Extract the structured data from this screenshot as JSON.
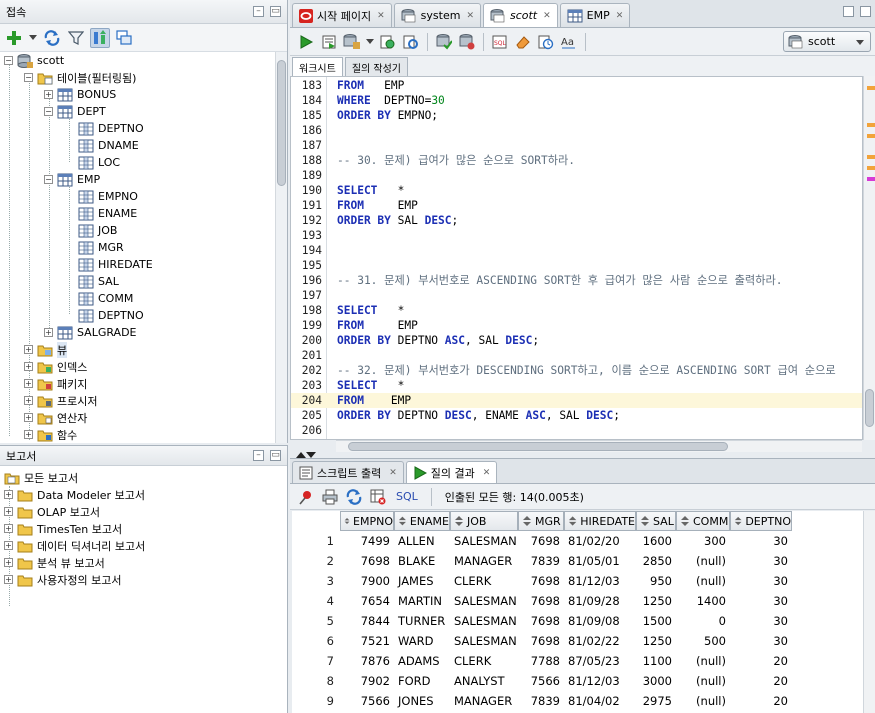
{
  "connections_panel": {
    "title": "접속",
    "tree": {
      "root": "scott",
      "tables_folder": "테이블(필터링됨)",
      "tables": [
        "BONUS",
        "DEPT",
        "EMP",
        "SALGRADE"
      ],
      "dept_columns": [
        "DEPTNO",
        "DNAME",
        "LOC"
      ],
      "emp_columns": [
        "EMPNO",
        "ENAME",
        "JOB",
        "MGR",
        "HIREDATE",
        "SAL",
        "COMM",
        "DEPTNO"
      ],
      "other_folders": [
        "뷰",
        "인덱스",
        "패키지",
        "프로시저",
        "연산자",
        "함수"
      ]
    }
  },
  "reports_panel": {
    "title": "보고서",
    "root": "모든 보고서",
    "items": [
      "Data Modeler 보고서",
      "OLAP 보고서",
      "TimesTen 보고서",
      "데이터 딕셔너리 보고서",
      "분석 뷰 보고서",
      "사용자정의 보고서"
    ]
  },
  "doc_tabs": [
    "시작 페이지",
    "system",
    "scott",
    "EMP"
  ],
  "active_doc_tab": "scott",
  "connection_selector": "scott",
  "sub_tabs": [
    "워크시트",
    "질의 작성기"
  ],
  "editor": {
    "lines": [
      {
        "n": "183",
        "parts": [
          [
            "kw",
            "FROM"
          ],
          [
            "t",
            "   EMP"
          ]
        ]
      },
      {
        "n": "184",
        "parts": [
          [
            "kw",
            "WHERE"
          ],
          [
            "t",
            "  DEPTNO="
          ],
          [
            "num",
            "30"
          ]
        ]
      },
      {
        "n": "185",
        "parts": [
          [
            "kw",
            "ORDER BY"
          ],
          [
            "t",
            " EMPNO;"
          ]
        ]
      },
      {
        "n": "186",
        "parts": []
      },
      {
        "n": "187",
        "parts": []
      },
      {
        "n": "188",
        "parts": [
          [
            "cm",
            "-- 30. 문제) 급여가 많은 순으로 SORT하라."
          ]
        ]
      },
      {
        "n": "189",
        "parts": []
      },
      {
        "n": "190",
        "parts": [
          [
            "kw",
            "SELECT"
          ],
          [
            "t",
            "   *"
          ]
        ]
      },
      {
        "n": "191",
        "parts": [
          [
            "kw",
            "FROM"
          ],
          [
            "t",
            "     EMP"
          ]
        ]
      },
      {
        "n": "192",
        "parts": [
          [
            "kw",
            "ORDER BY"
          ],
          [
            "t",
            " SAL "
          ],
          [
            "kw",
            "DESC"
          ],
          [
            "t",
            ";"
          ]
        ]
      },
      {
        "n": "193",
        "parts": []
      },
      {
        "n": "194",
        "parts": []
      },
      {
        "n": "195",
        "parts": []
      },
      {
        "n": "196",
        "parts": [
          [
            "cm",
            "-- 31. 문제) 부서번호로 ASCENDING SORT한 후 급여가 많은 사람 순으로 출력하라."
          ]
        ]
      },
      {
        "n": "197",
        "parts": []
      },
      {
        "n": "198",
        "parts": [
          [
            "kw",
            "SELECT"
          ],
          [
            "t",
            "   *"
          ]
        ]
      },
      {
        "n": "199",
        "parts": [
          [
            "kw",
            "FROM"
          ],
          [
            "t",
            "     EMP"
          ]
        ]
      },
      {
        "n": "200",
        "parts": [
          [
            "kw",
            "ORDER BY"
          ],
          [
            "t",
            " DEPTNO "
          ],
          [
            "kw",
            "ASC"
          ],
          [
            "t",
            ", SAL "
          ],
          [
            "kw",
            "DESC"
          ],
          [
            "t",
            ";"
          ]
        ]
      },
      {
        "n": "201",
        "parts": []
      },
      {
        "n": "202",
        "parts": [
          [
            "cm",
            "-- 32. 문제) 부서번호가 DESCENDING SORT하고, 이름 순으로 ASCENDING SORT 급여 순으로"
          ]
        ]
      },
      {
        "n": "203",
        "parts": [
          [
            "kw",
            "SELECT"
          ],
          [
            "t",
            "   *"
          ]
        ]
      },
      {
        "n": "204",
        "parts": [
          [
            "kw",
            "FROM"
          ],
          [
            "t",
            "    EMP"
          ]
        ],
        "current": true
      },
      {
        "n": "205",
        "parts": [
          [
            "kw",
            "ORDER BY"
          ],
          [
            "t",
            " DEPTNO "
          ],
          [
            "kw",
            "DESC"
          ],
          [
            "t",
            ", ENAME "
          ],
          [
            "kw",
            "ASC"
          ],
          [
            "t",
            ", SAL "
          ],
          [
            "kw",
            "DESC"
          ],
          [
            "t",
            ";"
          ]
        ]
      },
      {
        "n": "206",
        "parts": []
      }
    ]
  },
  "result_tabs": [
    "스크립트 출력",
    "질의 결과"
  ],
  "result_toolbar": {
    "sql_label": "SQL",
    "status": "인출된 모든 행: 14(0.005초)"
  },
  "grid": {
    "columns": [
      "EMPNO",
      "ENAME",
      "JOB",
      "MGR",
      "HIREDATE",
      "SAL",
      "COMM",
      "DEPTNO"
    ],
    "rows": [
      [
        "1",
        "7499",
        "ALLEN",
        "SALESMAN",
        "7698",
        "81/02/20",
        "1600",
        "300",
        "30"
      ],
      [
        "2",
        "7698",
        "BLAKE",
        "MANAGER",
        "7839",
        "81/05/01",
        "2850",
        "(null)",
        "30"
      ],
      [
        "3",
        "7900",
        "JAMES",
        "CLERK",
        "7698",
        "81/12/03",
        "950",
        "(null)",
        "30"
      ],
      [
        "4",
        "7654",
        "MARTIN",
        "SALESMAN",
        "7698",
        "81/09/28",
        "1250",
        "1400",
        "30"
      ],
      [
        "5",
        "7844",
        "TURNER",
        "SALESMAN",
        "7698",
        "81/09/08",
        "1500",
        "0",
        "30"
      ],
      [
        "6",
        "7521",
        "WARD",
        "SALESMAN",
        "7698",
        "81/02/22",
        "1250",
        "500",
        "30"
      ],
      [
        "7",
        "7876",
        "ADAMS",
        "CLERK",
        "7788",
        "87/05/23",
        "1100",
        "(null)",
        "20"
      ],
      [
        "8",
        "7902",
        "FORD",
        "ANALYST",
        "7566",
        "81/12/03",
        "3000",
        "(null)",
        "20"
      ],
      [
        "9",
        "7566",
        "JONES",
        "MANAGER",
        "7839",
        "81/04/02",
        "2975",
        "(null)",
        "20"
      ]
    ]
  },
  "colors": {
    "keyword": "#1c2fb4",
    "comment": "#5f6f7f",
    "number": "#00851a",
    "current_line": "#fdf7da"
  }
}
